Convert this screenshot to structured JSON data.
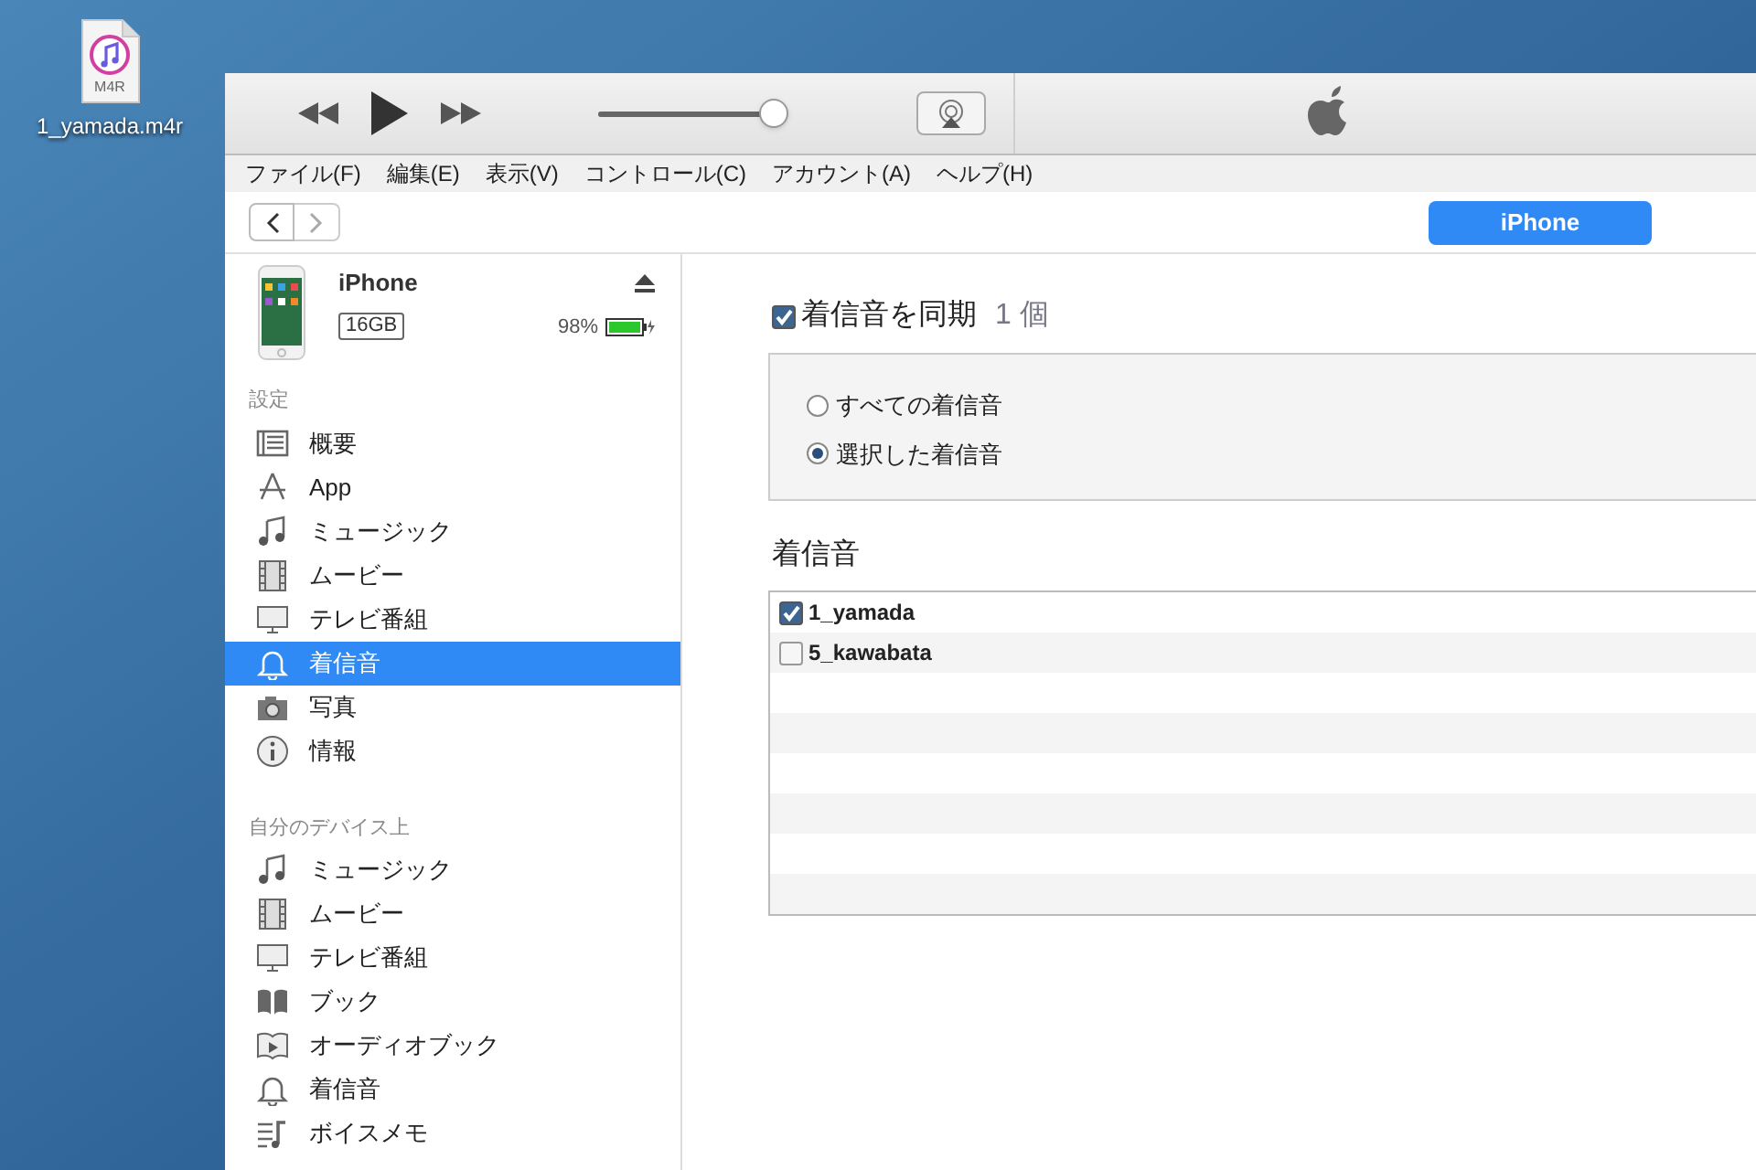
{
  "desktop_file": {
    "type_label": "M4R",
    "name": "1_yamada.m4r"
  },
  "player": {
    "volume": {
      "level": 0.96
    }
  },
  "menu": [
    "ファイル(F)",
    "編集(E)",
    "表示(V)",
    "コントロール(C)",
    "アカウント(A)",
    "ヘルプ(H)"
  ],
  "device_button": {
    "label": "iPhone"
  },
  "device": {
    "name": "iPhone",
    "capacity": "16GB",
    "battery": "98%"
  },
  "sidebar": [
    {
      "title": "設定",
      "items": [
        {
          "label": "概要",
          "selected": false
        },
        {
          "label": "App",
          "selected": false
        },
        {
          "label": "ミュージック",
          "selected": false
        },
        {
          "label": "ムービー",
          "selected": false
        },
        {
          "label": "テレビ番組",
          "selected": false
        },
        {
          "label": "着信音",
          "selected": true
        },
        {
          "label": "写真",
          "selected": false
        },
        {
          "label": "情報",
          "selected": false
        }
      ]
    },
    {
      "title": "自分のデバイス上",
      "items": [
        {
          "label": "ミュージック",
          "selected": false
        },
        {
          "label": "ムービー",
          "selected": false
        },
        {
          "label": "テレビ番組",
          "selected": false
        },
        {
          "label": "ブック",
          "selected": false
        },
        {
          "label": "オーディオブック",
          "selected": false
        },
        {
          "label": "着信音",
          "selected": false
        },
        {
          "label": "ボイスメモ",
          "selected": false
        }
      ]
    }
  ],
  "sync": {
    "label": "着信音を同期",
    "count": "1 個",
    "checked": true
  },
  "options": [
    {
      "label": "すべての着信音",
      "selected": false
    },
    {
      "label": "選択した着信音",
      "selected": true
    }
  ],
  "list_title": "着信音",
  "ringtones": [
    {
      "name": "1_yamada",
      "checked": true
    },
    {
      "name": "5_kawabata",
      "checked": false
    }
  ]
}
